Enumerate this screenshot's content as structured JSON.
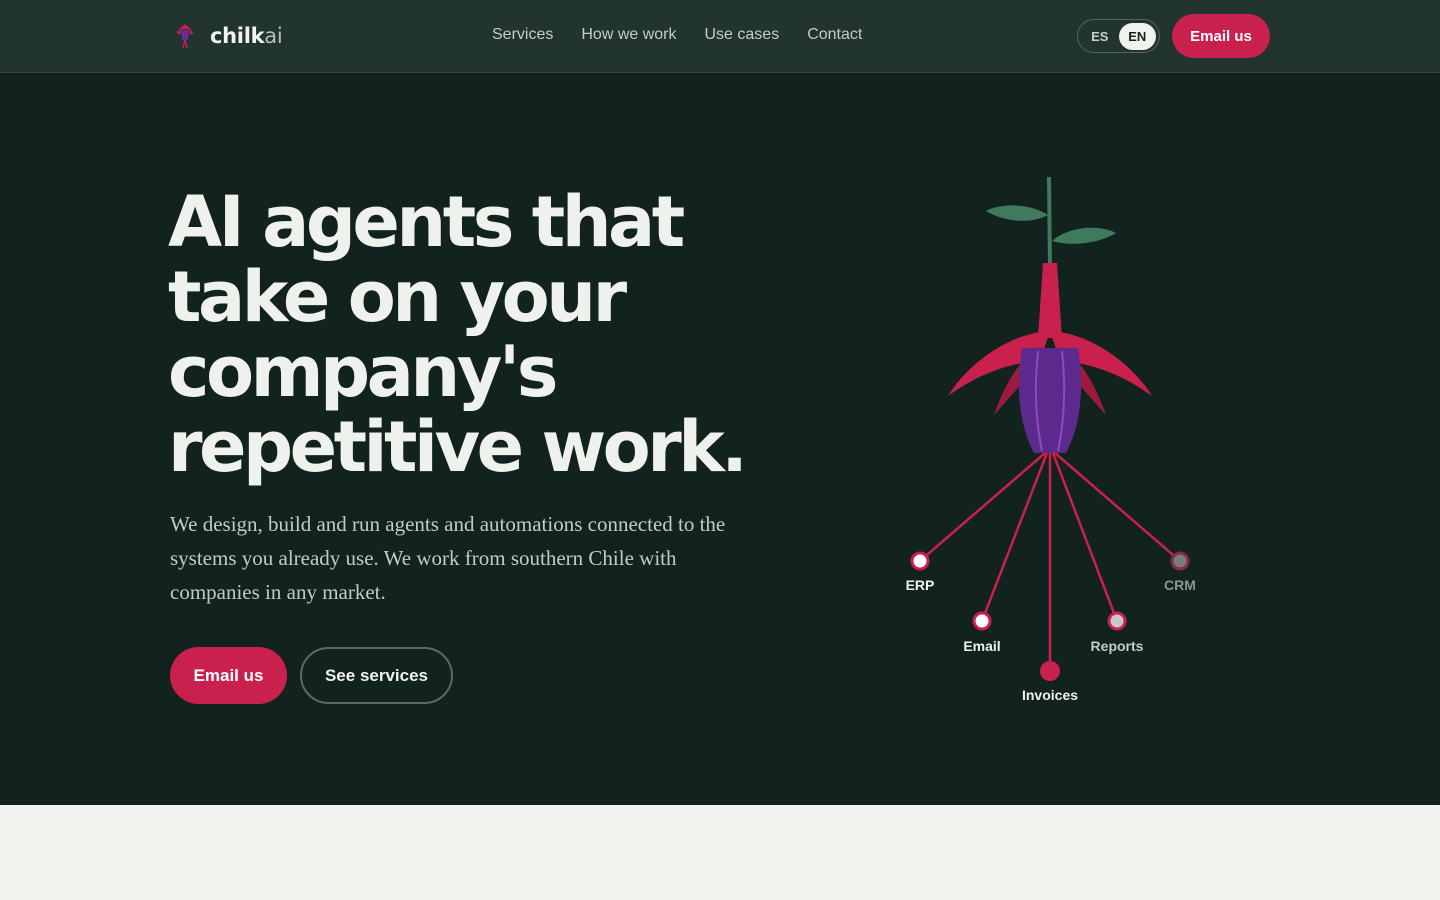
{
  "brand": {
    "name_main": "chilk",
    "name_suffix": "ai"
  },
  "nav": {
    "items": [
      "Services",
      "How we work",
      "Use cases",
      "Contact"
    ]
  },
  "lang": {
    "options": [
      "ES",
      "EN"
    ],
    "active": "EN"
  },
  "header": {
    "cta_label": "Email us"
  },
  "hero": {
    "headline_lines": [
      "AI agents that",
      "take on your",
      "company's",
      "repetitive work."
    ],
    "subtitle": "We design, build and run agents and automations connected to the systems you already use. We work from southern Chile with companies in any market.",
    "primary_cta": "Email us",
    "secondary_cta": "See services"
  },
  "illustration": {
    "nodes": [
      "ERP",
      "Email",
      "Invoices",
      "Reports",
      "CRM"
    ]
  },
  "colors": {
    "accent": "#c9204d",
    "hero_bg": "#12221e",
    "header_bg": "#213430",
    "petal_purple": "#5c2a8c",
    "leaf_green": "#3f7a5c"
  }
}
